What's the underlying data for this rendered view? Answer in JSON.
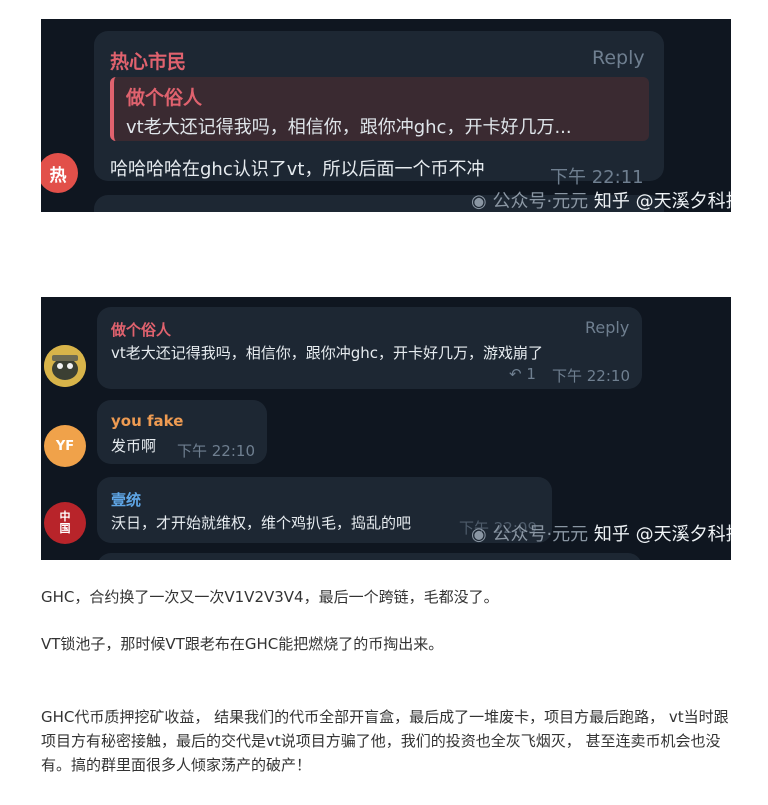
{
  "shot1": {
    "sender": "热心市民",
    "reply_label": "Reply",
    "quote_author": "做个俗人",
    "quote_text": "vt老大还记得我吗，相信你，跟你冲ghc，开卡好几万...",
    "message": "哈哈哈哈在ghc认识了vt，所以后面一个币不冲",
    "time": "下午 22:11",
    "avatar_letter": "热",
    "watermark_account": "公众号·元元",
    "watermark_main": "知乎 @天溪夕科技"
  },
  "shot2": {
    "msg1": {
      "sender": "做个俗人",
      "reply_label": "Reply",
      "text": "vt老大还记得我吗，相信你，跟你冲ghc，开卡好几万，游戏崩了",
      "reply_count": "1",
      "time": "下午 22:10"
    },
    "msg2": {
      "sender": "you fake",
      "avatar_letters": "YF",
      "text": "发币啊",
      "time": "下午 22:10"
    },
    "msg3": {
      "sender": "壹统",
      "avatar_text": "中\n国",
      "text": "沃日，才开始就维权，维个鸡扒毛，捣乱的吧",
      "time": "下午 22:09"
    },
    "watermark_account": "公众号·元元",
    "watermark_main": "知乎 @天溪夕科技"
  },
  "paragraphs": [
    "GHC，合约换了一次又一次V1V2V3V4，最后一个跨链，毛都没了。",
    "VT锁池子，那时候VT跟老布在GHC能把燃烧了的币掏出来。",
    "GHC代币质押挖矿收益， 结果我们的代币全部开盲盒，最后成了一堆废卡，项目方最后跑路， vt当时跟项目方有秘密接触，最后的交代是vt说项目方骗了他，我们的投资也全灰飞烟灭， 甚至连卖币机会也没有。搞的群里面很多人倾家荡产的破产！"
  ],
  "colors": {
    "chat_bg": "#0f1620",
    "bubble_bg": "#1d2733",
    "red_name": "#e0626e",
    "orange_name": "#ee9b52",
    "blue_name": "#5fa6e6",
    "meta": "#6f7f90"
  }
}
